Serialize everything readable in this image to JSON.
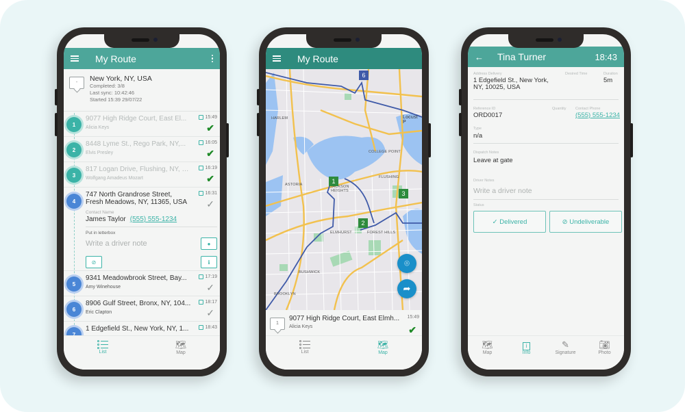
{
  "colors": {
    "primary": "#4da69a",
    "accent": "#3bb3a7",
    "done_check": "#1f8a28",
    "pending_badge": "#4a86d6",
    "map_fab": "#1a8fc9",
    "background": "#eaf6f7"
  },
  "phone1": {
    "appbar": {
      "title": "My Route",
      "menu_icon": "hamburger-menu-icon",
      "overflow_icon": "more-vertical-icon"
    },
    "summary": {
      "icon_text": "-",
      "city": "New York, NY, USA",
      "completed": "Completed: 3/8",
      "last_sync": "Last sync: 10:42:46",
      "started": "Started 15:39 29/07/22"
    },
    "stops": [
      {
        "number": "1",
        "address": "9077 High Ridge Court, East El...",
        "person": "Alicia Keys",
        "time": "15:49",
        "status": "done"
      },
      {
        "number": "2",
        "address": "8448 Lyme St., Rego Park, NY,...",
        "person": "Elvis Presley",
        "time": "16:05",
        "status": "done"
      },
      {
        "number": "3",
        "address": "817 Logan Drive, Flushing, NY, 11...",
        "person": "Wolfgang Amadeus Mozart",
        "time": "16:19",
        "status": "done"
      },
      {
        "number": "4",
        "address_line1": "747 North Grandrose Street,",
        "address_line2": "Fresh Meadows, NY, 11365, USA",
        "time": "16:31",
        "status": "pending",
        "contact_label": "Contact Name",
        "contact_name": "James Taylor",
        "contact_phone": "(555) 555-1234",
        "dispatch_note": "Put in letterbox",
        "driver_note_placeholder": "Write a driver note"
      },
      {
        "number": "5",
        "address": "9341 Meadowbrook Street, Bay...",
        "person": "Amy Winehouse",
        "time": "17:19",
        "status": "pending"
      },
      {
        "number": "6",
        "address": "8906 Gulf Street, Bronx, NY, 104...",
        "person": "Eric Clapton",
        "time": "18:17",
        "status": "pending"
      },
      {
        "number": "7",
        "address": "1 Edgefield St., New York, NY, 1...",
        "person": "",
        "time": "18:43",
        "status": "pending"
      }
    ],
    "nav": [
      {
        "label": "List",
        "icon": "list-icon",
        "active": true
      },
      {
        "label": "Map",
        "icon": "map-icon",
        "active": false
      }
    ]
  },
  "phone2": {
    "appbar": {
      "title": "My Route",
      "menu_icon": "hamburger-menu-icon"
    },
    "map": {
      "labels": [
        "HARLEM",
        "ASTORIA",
        "JACKSON HEIGHTS",
        "COLLEGE POINT",
        "FLUSHING",
        "ELMHURST",
        "FOREST HILLS",
        "BUSHWICK",
        "BROOKLYN",
        "Locust P"
      ],
      "markers": [
        "6",
        "1",
        "3",
        "2"
      ],
      "fab_recenter_icon": "recenter-focus-icon",
      "fab_navigate_icon": "navigate-turn-right-icon"
    },
    "card": {
      "number": "1",
      "address": "9077 High Ridge Court, East Elmh...",
      "person": "Alicia Keys",
      "time": "15:49"
    },
    "nav": [
      {
        "label": "List",
        "icon": "list-icon",
        "active": false
      },
      {
        "label": "Map",
        "icon": "map-icon",
        "active": true
      }
    ]
  },
  "phone3": {
    "appbar": {
      "back_icon": "arrow-back-icon",
      "title": "Tina Turner",
      "time": "18:43"
    },
    "fields": {
      "address_label": "Address Delivery",
      "address_line1": "1 Edgefield St., New York,",
      "address_line2": "NY, 10025, USA",
      "desired_time_label": "Desired Time",
      "desired_time": "",
      "duration_label": "Duration",
      "duration": "5m",
      "reference_label": "Reference ID",
      "reference": "ORD0017",
      "quantity_label": "Quantity",
      "quantity": "",
      "contact_phone_label": "Contact Phone",
      "contact_phone": "(555) 555-1234",
      "type_label": "Type",
      "type": "n/a",
      "dispatch_label": "Dispatch Notes",
      "dispatch": "Leave at gate",
      "driver_notes_label": "Driver Notes",
      "driver_notes_placeholder": "Write a driver note",
      "status_label": "Status"
    },
    "buttons": {
      "delivered": "✓ Delivered",
      "undeliverable": "⊘ Undeliverable"
    },
    "nav": [
      {
        "label": "Map",
        "icon": "map-icon",
        "active": false
      },
      {
        "label": "Info",
        "icon": "info-icon",
        "active": true
      },
      {
        "label": "Signature",
        "icon": "pencil-icon",
        "active": false
      },
      {
        "label": "Photo",
        "icon": "camera-icon",
        "active": false
      }
    ]
  }
}
